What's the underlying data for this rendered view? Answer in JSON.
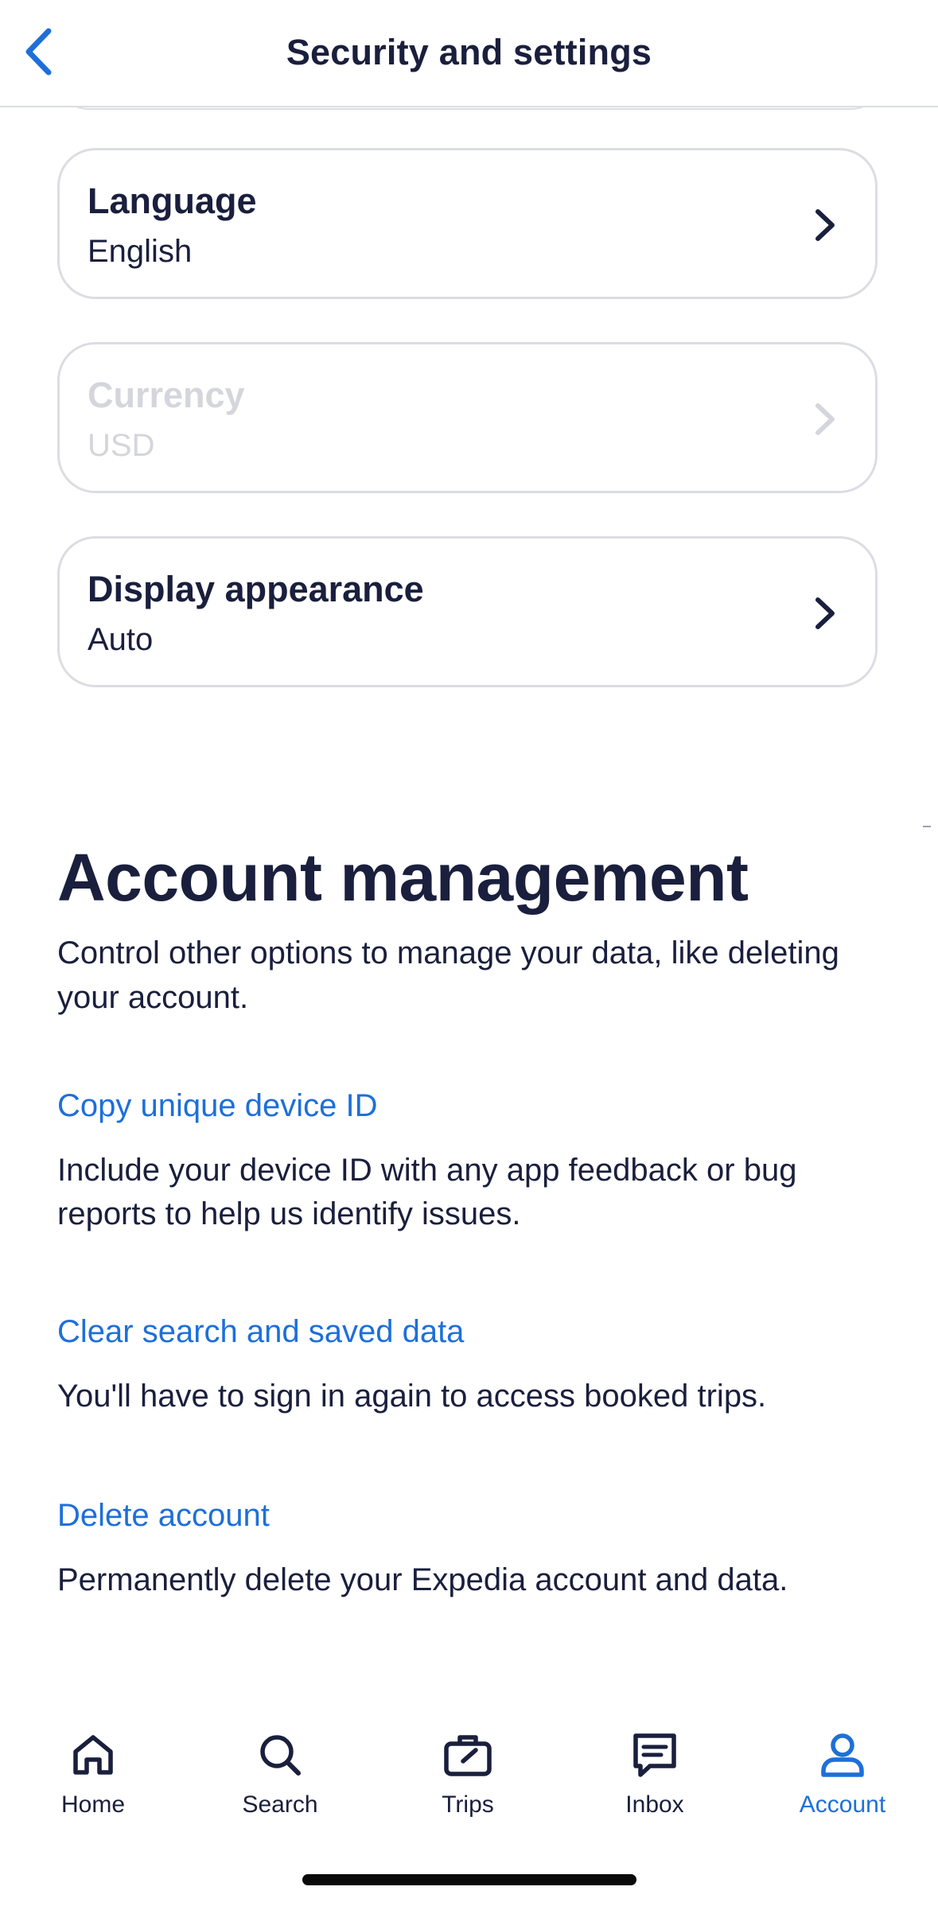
{
  "header": {
    "title": "Security and settings"
  },
  "settings": [
    {
      "label": "Language",
      "value": "English",
      "enabled": true
    },
    {
      "label": "Currency",
      "value": "USD",
      "enabled": false
    },
    {
      "label": "Display appearance",
      "value": "Auto",
      "enabled": true
    }
  ],
  "account_management": {
    "title": "Account management",
    "description": "Control other options to manage your data, like deleting your account.",
    "actions": [
      {
        "link": "Copy unique device ID",
        "description": "Include your device ID with any app feedback or bug reports to help us identify issues."
      },
      {
        "link": "Clear search and saved data",
        "description": "You'll have to sign in again to access booked trips."
      },
      {
        "link": "Delete account",
        "description": "Permanently delete your Expedia account and data."
      }
    ]
  },
  "tabbar": {
    "items": [
      {
        "label": "Home",
        "icon": "home-icon",
        "active": false
      },
      {
        "label": "Search",
        "icon": "search-icon",
        "active": false
      },
      {
        "label": "Trips",
        "icon": "suitcase-icon",
        "active": false
      },
      {
        "label": "Inbox",
        "icon": "chat-icon",
        "active": false
      },
      {
        "label": "Account",
        "icon": "user-icon",
        "active": true
      }
    ]
  },
  "colors": {
    "text": "#1a1f3d",
    "accent": "#1e6fd9",
    "border": "#dcdde3",
    "disabled": "#d5d6dc"
  }
}
